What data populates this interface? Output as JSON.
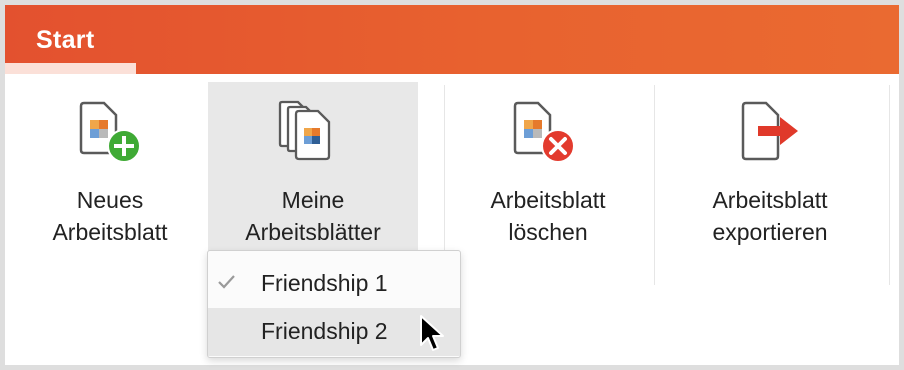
{
  "ribbon": {
    "tab_label": "Start",
    "brand_color": "#e3512f"
  },
  "buttons": {
    "new": {
      "line1": "Neues",
      "line2": "Arbeitsblatt",
      "icon": "new-worksheet-icon"
    },
    "mine": {
      "line1": "Meine",
      "line2": "Arbeitsblätter",
      "icon": "my-worksheets-icon"
    },
    "delete": {
      "line1": "Arbeitsblatt",
      "line2": "löschen",
      "icon": "delete-worksheet-icon"
    },
    "export": {
      "line1": "Arbeitsblatt",
      "line2": "exportieren",
      "icon": "export-worksheet-icon"
    }
  },
  "dropdown": {
    "items": [
      {
        "label": "Friendship 1",
        "checked": true
      },
      {
        "label": "Friendship 2",
        "checked": false,
        "hovered": true
      }
    ]
  },
  "colors": {
    "accent_orange": "#e3512f",
    "add_green": "#3faa35",
    "delete_red": "#e33b2e",
    "export_red": "#e0392a"
  }
}
